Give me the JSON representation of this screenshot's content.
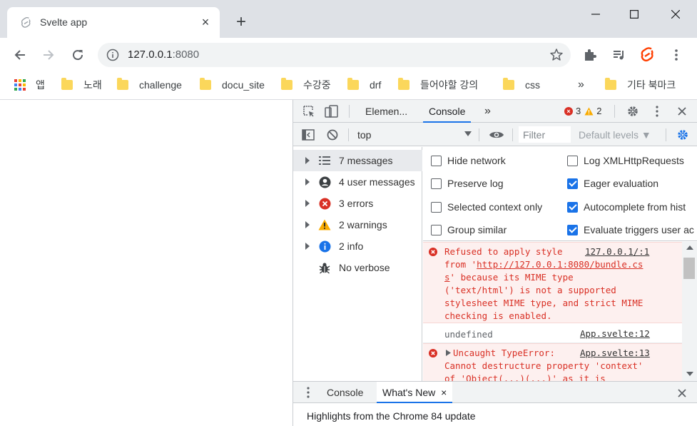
{
  "browser": {
    "tab": {
      "title": "Svelte app",
      "close_glyph": "×",
      "favicon": "svelte-icon"
    },
    "new_tab_glyph": "+",
    "window_controls": [
      "minimize-icon",
      "maximize-icon",
      "close-icon"
    ]
  },
  "toolbar": {
    "url_host": "127.0.0.1",
    "url_port": ":8080",
    "icons": [
      "back-arrow-icon",
      "forward-arrow-icon",
      "reload-icon",
      "info-icon",
      "star-icon",
      "extensions-puzzle-icon",
      "media-playlist-icon",
      "svelte-devtools-icon",
      "more-vert-icon"
    ]
  },
  "bookmarks": {
    "apps_label": "앱",
    "items": [
      "노래",
      "challenge",
      "docu_site",
      "수강중",
      "drf",
      "들어야할 강의",
      "css"
    ],
    "overflow_glyph": "»",
    "other": "기타 북마크"
  },
  "devtools": {
    "tabs": {
      "elements": "Elemen...",
      "console": "Console",
      "more": "»"
    },
    "error_count": "3",
    "warning_count": "2",
    "context": "top",
    "filter_placeholder": "Filter",
    "levels": "Default levels ▼",
    "sidebar": [
      {
        "label": "7 messages",
        "icon": "list-icon",
        "selected": true,
        "expandable": true
      },
      {
        "label": "4 user messages",
        "icon": "user-icon",
        "selected": false,
        "expandable": true
      },
      {
        "label": "3 errors",
        "icon": "error-icon",
        "selected": false,
        "expandable": true
      },
      {
        "label": "2 warnings",
        "icon": "warning-icon",
        "selected": false,
        "expandable": true
      },
      {
        "label": "2 info",
        "icon": "info-icon",
        "selected": false,
        "expandable": true
      },
      {
        "label": "No verbose",
        "icon": "bug-icon",
        "selected": false,
        "expandable": false
      }
    ],
    "settings": {
      "left": [
        {
          "label": "Hide network",
          "checked": false
        },
        {
          "label": "Preserve log",
          "checked": false
        },
        {
          "label": "Selected context only",
          "checked": false
        },
        {
          "label": "Group similar",
          "checked": false
        }
      ],
      "right": [
        {
          "label": "Log XMLHttpRequests",
          "checked": false
        },
        {
          "label": "Eager evaluation",
          "checked": true
        },
        {
          "label": "Autocomplete from hist",
          "checked": true
        },
        {
          "label": "Evaluate triggers user ac",
          "checked": true
        }
      ]
    },
    "messages": {
      "m1_source": "127.0.0.1/:1",
      "m1_line1": "Refused to apply style",
      "m1_line2a": "from '",
      "m1_url1": "http://127.0.0.1:8080/bundle.cs",
      "m1_url2": "s",
      "m1_line3b": "' because its MIME type",
      "m1_line4": "('text/html') is not a supported",
      "m1_line5": "stylesheet MIME type, and strict MIME",
      "m1_line6": "checking is enabled.",
      "m2_text": "undefined",
      "m2_source": "App.svelte:12",
      "m3_line1": "Uncaught TypeError:",
      "m3_source": "App.svelte:13",
      "m3_line2": "Cannot destructure property 'context'",
      "m3_line3": "of 'Object(...)(...)' as it is"
    },
    "drawer": {
      "console": "Console",
      "whats_new": "What's New",
      "whats_new_close": "×",
      "close": "×",
      "highlights": "Highlights from the Chrome 84 update"
    }
  },
  "colors": {
    "accent": "#1a73e8",
    "error": "#d93025",
    "warning": "#f9ab00",
    "svelte": "#ff3e00",
    "folder": "#fbd75b"
  }
}
